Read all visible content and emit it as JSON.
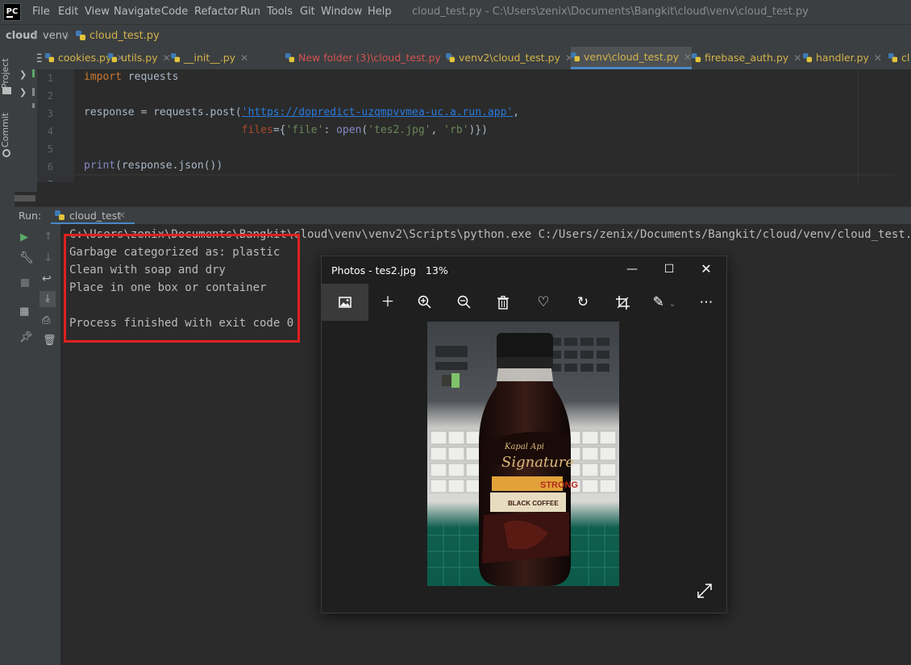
{
  "app": {
    "logo": "PC",
    "menu": [
      "File",
      "Edit",
      "View",
      "Navigate",
      "Code",
      "Refactor",
      "Run",
      "Tools",
      "Git",
      "Window",
      "Help"
    ],
    "title": "cloud_test.py - C:\\Users\\zenix\\Documents\\Bangkit\\cloud\\venv\\cloud_test.py"
  },
  "breadcrumb": [
    "cloud",
    "venv",
    "cloud_test.py"
  ],
  "side_tools": {
    "project": "Project",
    "commit": "Commit"
  },
  "tabs": [
    {
      "label": "cookies.py"
    },
    {
      "label": "utils.py"
    },
    {
      "label": "__init__.py"
    },
    {
      "label": "New folder (3)\\cloud_test.py"
    },
    {
      "label": "venv2\\cloud_test.py"
    },
    {
      "label": "venv\\cloud_test.py",
      "active": true
    },
    {
      "label": "firebase_auth.py"
    },
    {
      "label": "handler.py"
    },
    {
      "label": "cl"
    }
  ],
  "editor": {
    "line_numbers": [
      "1",
      "2",
      "3",
      "4",
      "5",
      "6",
      "7"
    ],
    "code": {
      "l1_kw": "import",
      "l1_rest": " requests",
      "l3_a": "response = requests.post(",
      "l3_url": "'https://dopredict-uzqmpvvmea-uc.a.run.app'",
      "l3_b": ",",
      "l4_indent": "                         ",
      "l4_param": "files",
      "l4_a": "={",
      "l4_s1": "'file'",
      "l4_b": ": ",
      "l4_fn": "open",
      "l4_c": "(",
      "l4_s2": "'tes2.jpg'",
      "l4_d": ", ",
      "l4_s3": "'rb'",
      "l4_e": ")})",
      "l6_fn": "print",
      "l6_rest": "(response.json())"
    }
  },
  "run": {
    "label": "Run:",
    "tab": "cloud_test",
    "output": [
      "C:\\Users\\zenix\\Documents\\Bangkit\\cloud\\venv\\venv2\\Scripts\\python.exe C:/Users/zenix/Documents/Bangkit/cloud/venv/cloud_test.py",
      "Garbage categorized as: plastic",
      "Clean with soap and dry",
      "Place in one box or container",
      "",
      "Process finished with exit code 0"
    ]
  },
  "photos": {
    "title": "Photos - tes2.jpg",
    "zoom": "13%",
    "toolbar": [
      "image-view-icon",
      "add-icon",
      "zoom-in-icon",
      "zoom-out-icon",
      "delete-icon",
      "favorite-icon",
      "rotate-icon",
      "crop-icon",
      "edit-icon",
      "more-icon"
    ],
    "bottle_label": {
      "brand": "Signature",
      "strong": "STRONG",
      "variant": "BLACK COFFEE"
    }
  },
  "colors": {
    "accent": "#4a88c7",
    "highlight_box": "#e02020",
    "py_tab_text": "#d3b34b"
  }
}
